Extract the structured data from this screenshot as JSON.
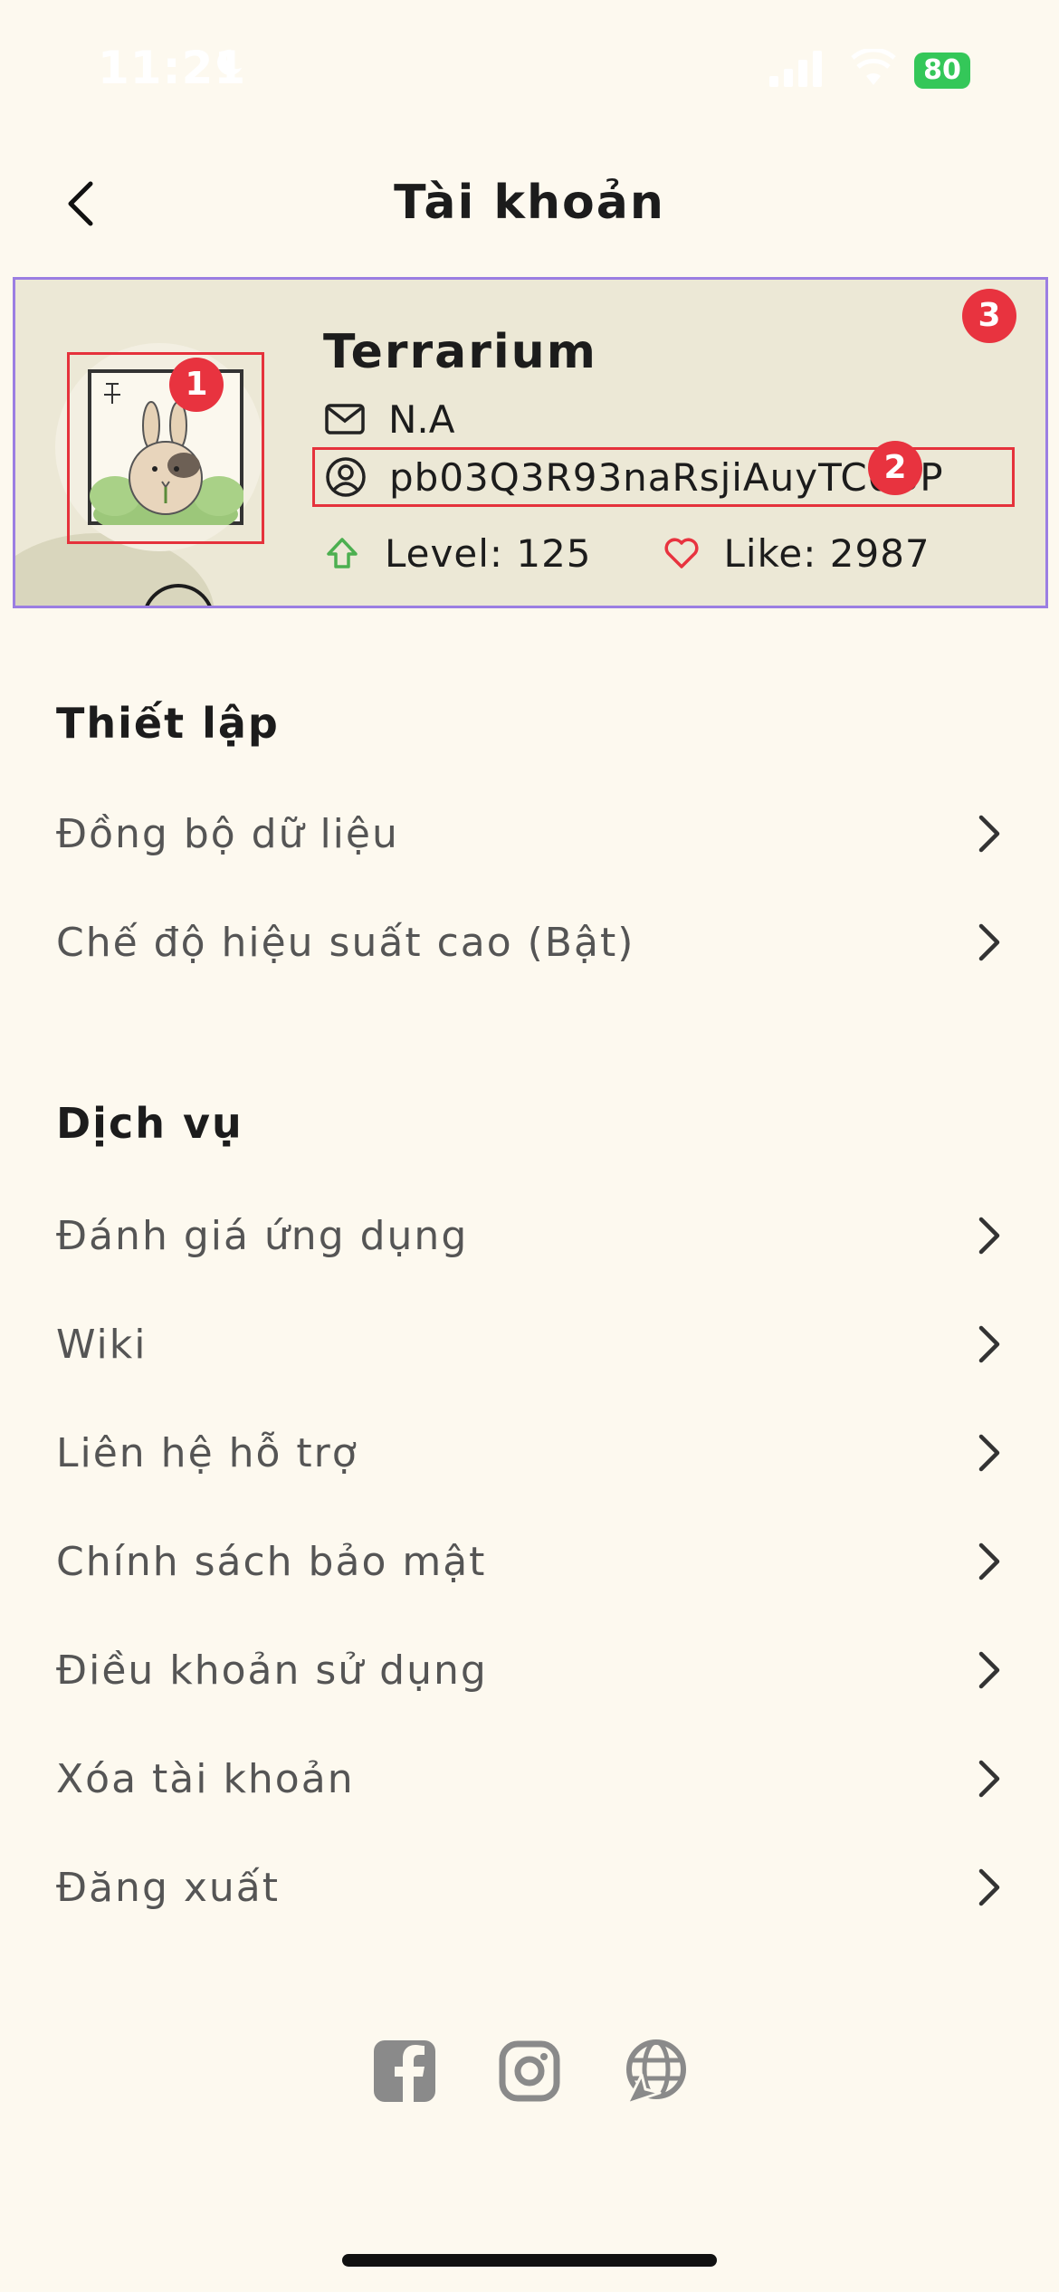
{
  "status_bar": {
    "time": "11:21",
    "battery": "80"
  },
  "header": {
    "title": "Tài khoản"
  },
  "profile": {
    "name": "Terrarium",
    "email": "N.A",
    "user_id": "pb03Q3R93naRsjiAuyTC0BP",
    "level": "Level: 125",
    "likes": "Like: 2987"
  },
  "annotations": {
    "badge_1": "1",
    "badge_2": "2",
    "badge_3": "3"
  },
  "settings": {
    "title": "Thiết lập",
    "items": [
      {
        "label": "Đồng bộ dữ liệu"
      },
      {
        "label": "Chế độ hiệu suất cao (Bật)"
      }
    ]
  },
  "services": {
    "title": "Dịch vụ",
    "items": [
      {
        "label": "Đánh giá ứng dụng"
      },
      {
        "label": "Wiki"
      },
      {
        "label": "Liên hệ hỗ trợ"
      },
      {
        "label": "Chính sách bảo mật"
      },
      {
        "label": "Điều khoản sử dụng"
      },
      {
        "label": "Xóa tài khoản"
      },
      {
        "label": "Đăng xuất"
      }
    ]
  },
  "social": [
    "facebook-icon",
    "instagram-icon",
    "website-icon"
  ],
  "colors": {
    "background": "#fdf9ef",
    "card": "#ece8d6",
    "accent_red": "#e8333f",
    "green": "#4caf50",
    "battery": "#34c759"
  }
}
